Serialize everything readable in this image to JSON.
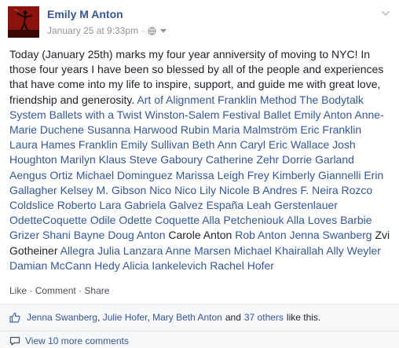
{
  "post": {
    "author": "Emily M Anton",
    "timestamp": "January 25 at 9:33pm",
    "separator": "·",
    "privacy_icon": "globe-icon",
    "menu_icon": "chevron-down-icon",
    "text_intro": "Today (January 25th) marks my four year anniversity of moving to NYC! In those four years I have been so blessed by all of the people and experiences that have come into my life to inspire, support, and guide me with great love, friendship and generosity.",
    "tags_group1": [
      "Art of Alignment",
      "Franklin Method",
      "The Bodytalk System",
      "Ballets with a Twist",
      "Winston-Salem Festival Ballet",
      "Emily Anton",
      "Anne-Marie Duchene",
      "Susanna Harwood Rubin",
      "Maria Malmström",
      "Eric Franklin",
      "Laura Hames Franklin",
      "Emily Sullivan",
      "Beth Ann Caryl",
      "Eric Wallace",
      "Josh Houghton",
      "Marilyn Klaus",
      "Steve Gaboury",
      "Catherine Zehr",
      "Dorrie Garland",
      "Aengus Ortiz",
      "Michael Dominguez",
      "Marissa Leigh Frey",
      "Kimberly Giannelli",
      "Erin Gallagher",
      "Kelsey M. Gibson",
      "Nico Nico Lily",
      "Nicole B Andres",
      "F. Neira Rozco",
      "Coldslice",
      "Roberto Lara",
      "Gabriela Galvez",
      "España Leah Gerstenlauer",
      "OdetteCoquette",
      "Odile Odette Coquette",
      "Alla Petcheniouk",
      "Alla Loves Barbie",
      "Grizer",
      "Shani Bayne",
      "Doug Anton"
    ],
    "plain_name": "Carole Anton",
    "tags_group2": [
      "Rob Anton",
      "Jenna Swanberg"
    ],
    "plain_name2": "Zvi Gotheiner",
    "tags_group3": [
      "Allegra",
      "Julia Lanzara",
      "Anne Marsen",
      "Michael Khairallah",
      "Ally Weyler",
      "Damian McCann",
      "Hedy Alicia Iankelevich",
      "Rachel Hofer"
    ],
    "actions": {
      "like": "Like",
      "comment": "Comment",
      "share": "Share",
      "dot": "·"
    },
    "likes": {
      "icon": "thumbs-up-icon",
      "names": [
        "Jenna Swanberg",
        "Julie Hofer",
        "Mary Beth Anton"
      ],
      "and": "and",
      "others": "37 others",
      "suffix": "like this."
    },
    "more_comments": {
      "icon": "comment-bubble-icon",
      "label": "View 10 more comments"
    }
  },
  "colors": {
    "link": "#365899",
    "text": "#1d2129",
    "meta": "#90949c",
    "footer_bg": "#f6f7f9"
  }
}
